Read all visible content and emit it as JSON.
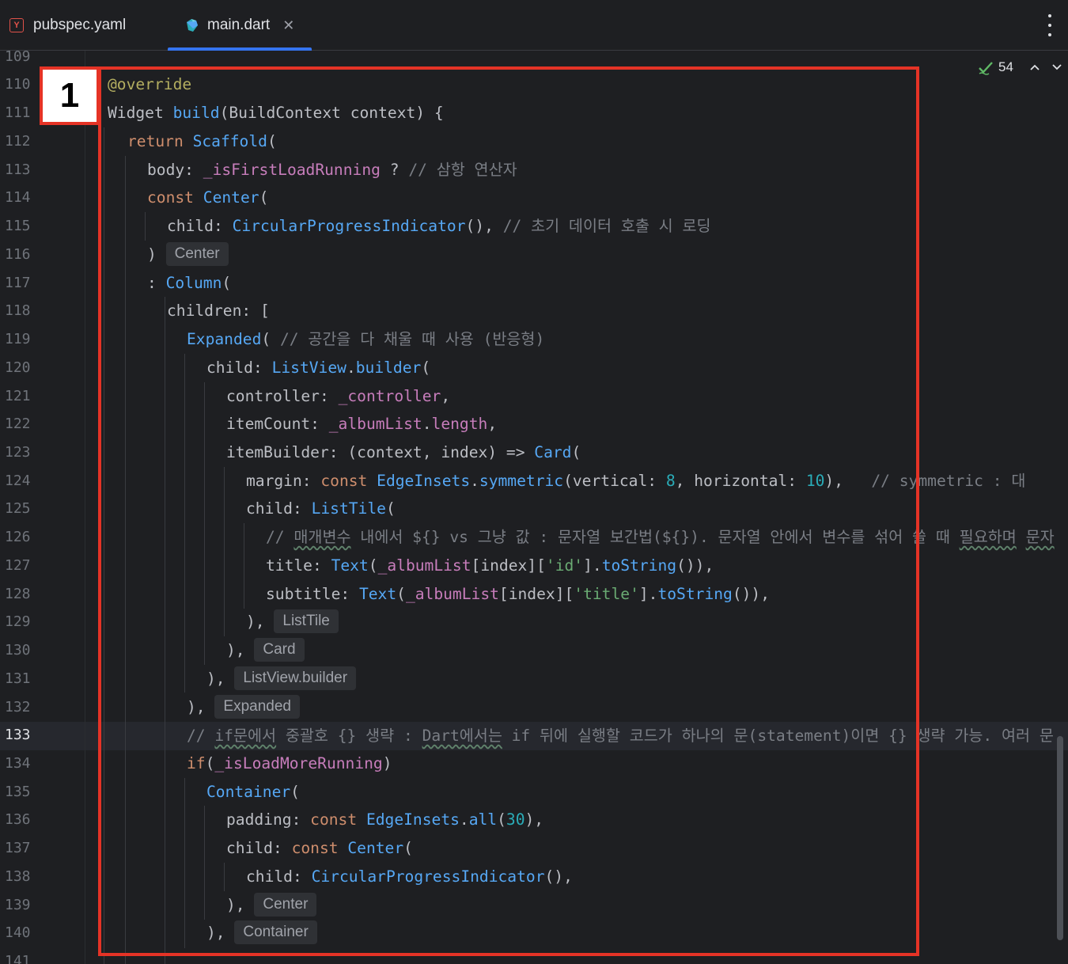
{
  "tabs": [
    {
      "label": "pubspec.yaml",
      "icon": "yaml-file-icon",
      "active": false
    },
    {
      "label": "main.dart",
      "icon": "dart-file-icon",
      "active": true
    }
  ],
  "tab_close_glyph": "✕",
  "inspection": {
    "count": "54"
  },
  "annotation_badge": "1",
  "line_numbers": [
    "109",
    "110",
    "111",
    "112",
    "113",
    "114",
    "115",
    "116",
    "117",
    "118",
    "119",
    "120",
    "121",
    "122",
    "123",
    "124",
    "125",
    "126",
    "127",
    "128",
    "129",
    "130",
    "131",
    "132",
    "133",
    "134",
    "135",
    "136",
    "137",
    "138",
    "139",
    "140",
    "141"
  ],
  "active_line": "133",
  "hints": {
    "center1": "Center",
    "listtile": "ListTile",
    "card": "Card",
    "listview": "ListView.builder",
    "expanded": "Expanded",
    "center2": "Center",
    "container": "Container"
  },
  "code": {
    "l110": [
      "@override"
    ],
    "l111": [
      "Widget ",
      "build",
      "(BuildContext context) {"
    ],
    "l112": [
      "return ",
      "Scaffold",
      "("
    ],
    "l113": [
      "body: ",
      "_isFirstLoadRunning",
      " ? ",
      "// 삼항 연산자"
    ],
    "l114": [
      "const ",
      "Center",
      "("
    ],
    "l115": [
      "child: ",
      "CircularProgressIndicator",
      "(), ",
      "// 초기 데이터 호출 시 로딩"
    ],
    "l116": [
      ") "
    ],
    "l117": [
      ": ",
      "Column",
      "("
    ],
    "l118": [
      "children: ["
    ],
    "l119": [
      "Expanded",
      "( ",
      "// 공간을 다 채울 때 사용 (반응형)"
    ],
    "l120": [
      "child: ",
      "ListView",
      ".",
      "builder",
      "("
    ],
    "l121": [
      "controller: ",
      "_controller",
      ","
    ],
    "l122": [
      "itemCount: ",
      "_albumList",
      ".",
      "length",
      ","
    ],
    "l123": [
      "itemBuilder: (context, index) => ",
      "Card",
      "("
    ],
    "l124": [
      "margin: ",
      "const ",
      "EdgeInsets",
      ".",
      "symmetric",
      "(vertical: ",
      "8",
      ", horizontal: ",
      "10",
      "),   ",
      "// symmetric : 대"
    ],
    "l125": [
      "child: ",
      "ListTile",
      "("
    ],
    "l126": [
      "// ",
      "매개변수",
      " 내에서 ${} vs 그냥 값 : 문자열 보간법(${}). 문자열 안에서 변수를 섞어 쓸 때 ",
      "필요하며",
      " ",
      "문자"
    ],
    "l127": [
      "title: ",
      "Text",
      "(",
      "_albumList",
      "[index][",
      "'id'",
      "].",
      "toString",
      "()),"
    ],
    "l128": [
      "subtitle: ",
      "Text",
      "(",
      "_albumList",
      "[index][",
      "'title'",
      "].",
      "toString",
      "()),"
    ],
    "l129": [
      "), "
    ],
    "l130": [
      "), "
    ],
    "l131": [
      "), "
    ],
    "l132": [
      "), "
    ],
    "l133": [
      "// ",
      "if문에서",
      " 중괄호 {} 생략 : ",
      "Dart에서는",
      " if 뒤에 실행할 코드가 하나의 문(statement)이면 {} 생략 가능. 여러 문"
    ],
    "l134": [
      "if",
      "(",
      "_isLoadMoreRunning",
      ")"
    ],
    "l135": [
      "Container",
      "("
    ],
    "l136": [
      "padding: ",
      "const ",
      "EdgeInsets",
      ".",
      "all",
      "(",
      "30",
      "),"
    ],
    "l137": [
      "child: ",
      "const ",
      "Center",
      "("
    ],
    "l138": [
      "child: ",
      "CircularProgressIndicator",
      "(),"
    ],
    "l139": [
      "), "
    ],
    "l140": [
      "), "
    ]
  }
}
